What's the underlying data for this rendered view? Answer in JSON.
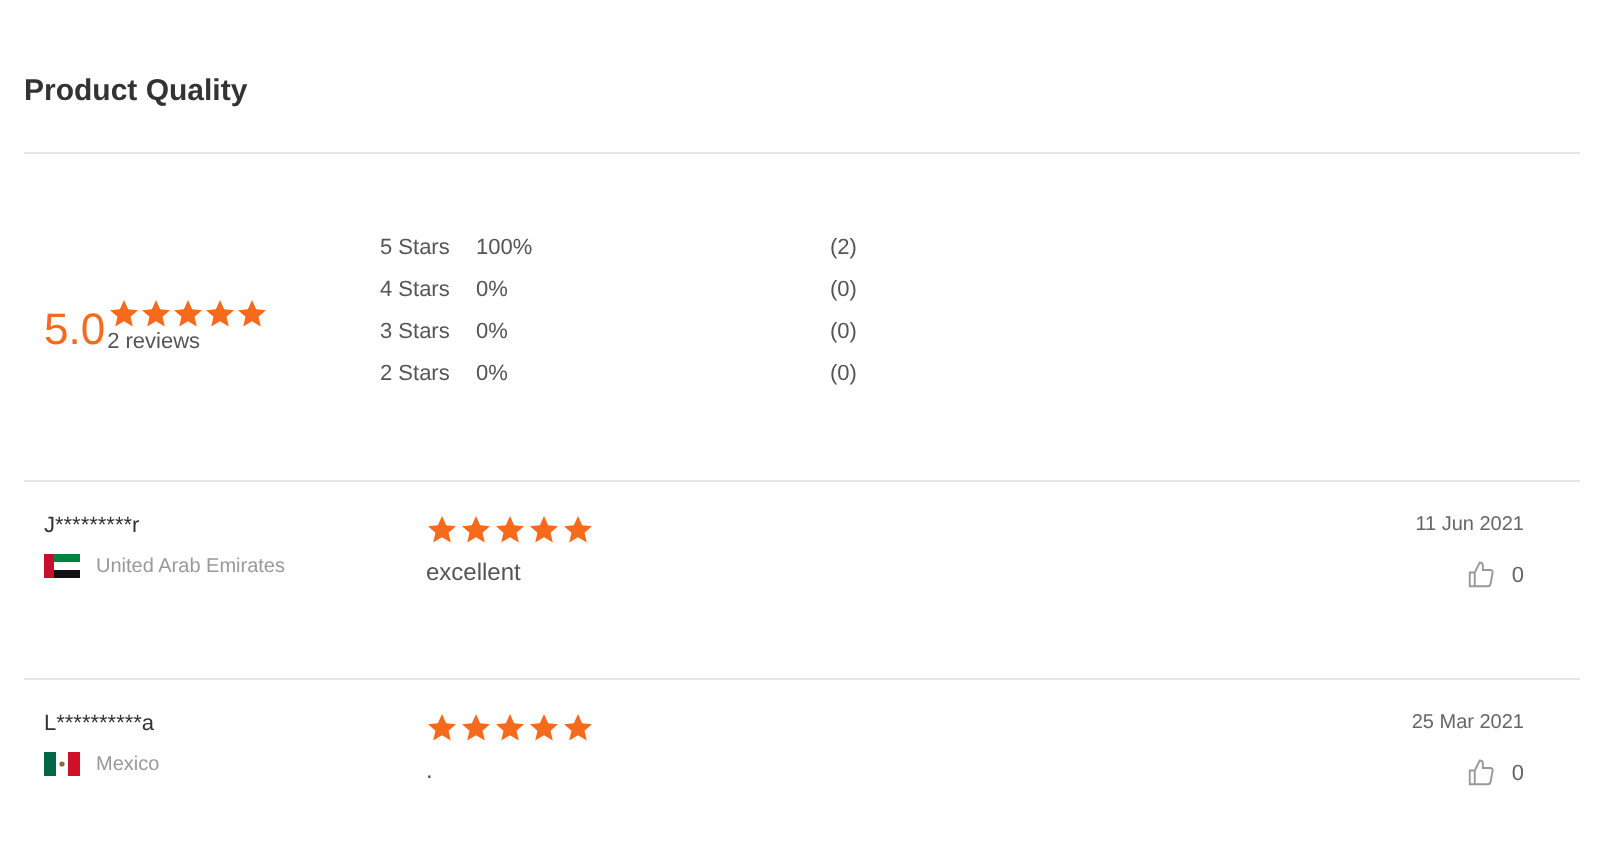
{
  "title": "Product Quality",
  "summary": {
    "score": "5.0",
    "stars": 5,
    "reviews": "2 reviews"
  },
  "breakdown": [
    {
      "label": "5 Stars",
      "percent": "100%",
      "count": "(2)"
    },
    {
      "label": "4 Stars",
      "percent": "0%",
      "count": "(0)"
    },
    {
      "label": "3 Stars",
      "percent": "0%",
      "count": "(0)"
    },
    {
      "label": "2 Stars",
      "percent": "0%",
      "count": "(0)"
    }
  ],
  "reviews": [
    {
      "name": "J*********r",
      "kind": "uae",
      "country": "United Arab Emirates",
      "stars": 5,
      "comment": "excellent",
      "date": "11 Jun 2021",
      "likes": "0"
    },
    {
      "name": "L**********a",
      "kind": "mexico",
      "country": "Mexico",
      "stars": 5,
      "comment": ".",
      "date": "25 Mar 2021",
      "likes": "0"
    }
  ]
}
